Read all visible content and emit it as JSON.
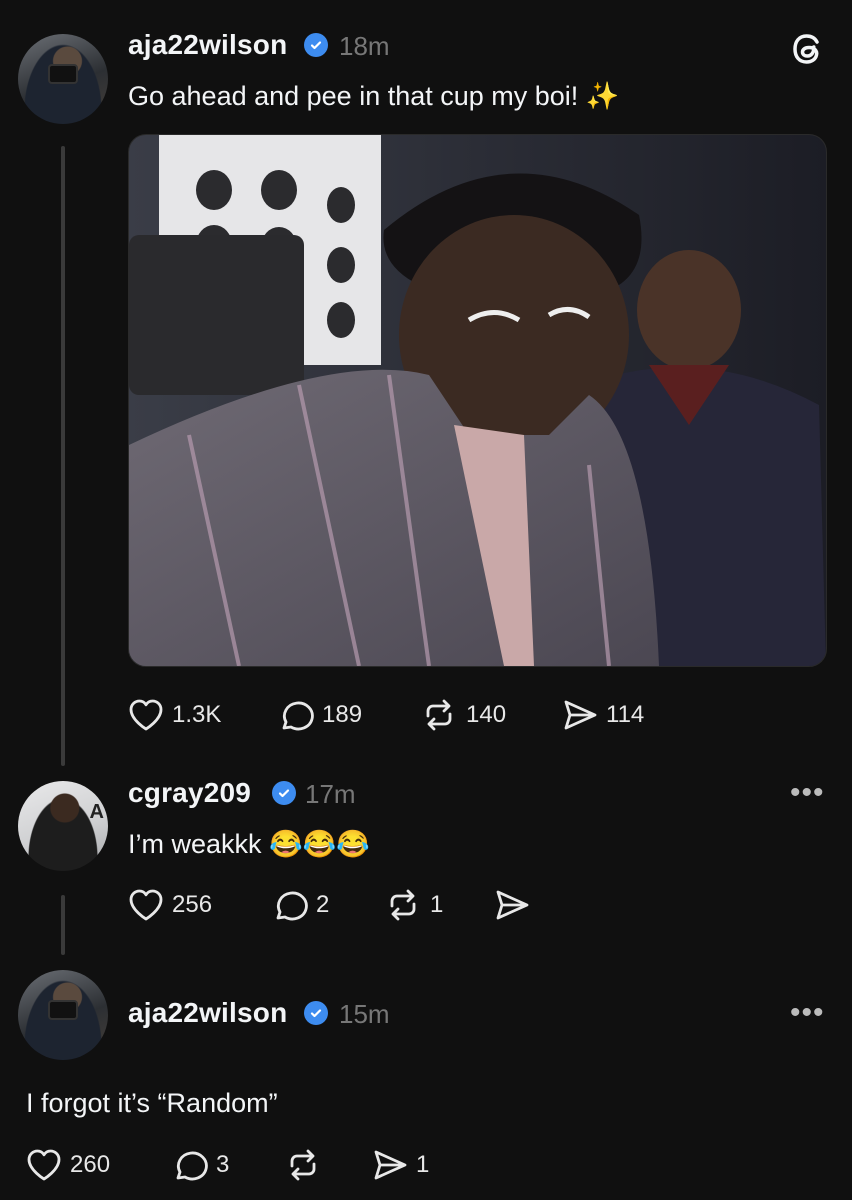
{
  "posts": [
    {
      "username": "aja22wilson",
      "time": "18m",
      "text": "Go ahead and pee in that cup my boi! ✨",
      "actions": {
        "likes": "1.3K",
        "replies": "189",
        "reposts": "140",
        "shares": "114"
      }
    },
    {
      "username": "cgray209",
      "time": "17m",
      "text": "I’m weakkk 😂😂😂",
      "actions": {
        "likes": "256",
        "replies": "2",
        "reposts": "1",
        "shares": ""
      }
    },
    {
      "username": "aja22wilson",
      "time": "15m",
      "text": "I forgot it’s “Random”",
      "actions": {
        "likes": "260",
        "replies": "3",
        "reposts": "",
        "shares": "1"
      }
    }
  ],
  "icons": {
    "app": "threads-logo-icon",
    "verified": "verified-badge-icon",
    "like": "heart-icon",
    "reply": "speech-bubble-icon",
    "repost": "repost-icon",
    "share": "paper-plane-icon",
    "more": "more-dots-icon"
  },
  "colors": {
    "background": "#101010",
    "verified": "#3d8cf0",
    "muted": "#777777"
  }
}
